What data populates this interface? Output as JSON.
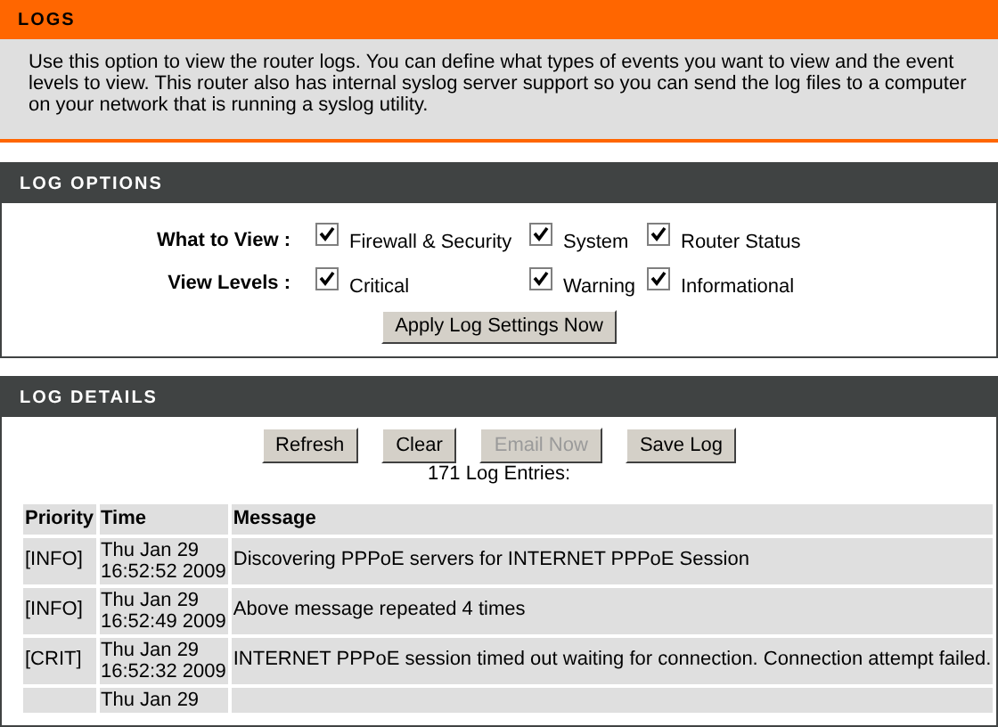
{
  "logs": {
    "title": "LOGS",
    "description": "Use this option to view the router logs. You can define what types of events you want to view and the event levels to view. This router also has internal syslog server support so you can send the log files to a computer on your network that is running a syslog utility."
  },
  "log_options": {
    "title": "LOG OPTIONS",
    "groups": [
      {
        "label": "What to View :",
        "options": [
          {
            "label": "Firewall & Security",
            "checked": true
          },
          {
            "label": "System",
            "checked": true
          },
          {
            "label": "Router Status",
            "checked": true
          }
        ]
      },
      {
        "label": "View Levels :",
        "options": [
          {
            "label": "Critical",
            "checked": true
          },
          {
            "label": "Warning",
            "checked": true
          },
          {
            "label": "Informational",
            "checked": true
          }
        ]
      }
    ],
    "apply_button": "Apply Log Settings Now"
  },
  "log_details": {
    "title": "LOG DETAILS",
    "buttons": [
      {
        "label": "Refresh",
        "disabled": false
      },
      {
        "label": "Clear",
        "disabled": false
      },
      {
        "label": "Email Now",
        "disabled": true
      },
      {
        "label": "Save Log",
        "disabled": false
      }
    ],
    "entries_count": "171 Log Entries:",
    "table": {
      "columns": [
        "Priority",
        "Time",
        "Message"
      ],
      "rows": [
        {
          "priority": "[INFO]",
          "time": [
            "Thu Jan 29",
            "16:52:52 2009"
          ],
          "message": "Discovering PPPoE servers for INTERNET PPPoE Session"
        },
        {
          "priority": "[INFO]",
          "time": [
            "Thu Jan 29",
            "16:52:49 2009"
          ],
          "message": "Above message repeated 4 times"
        },
        {
          "priority": "[CRIT]",
          "time": [
            "Thu Jan 29",
            "16:52:32 2009"
          ],
          "message": "INTERNET PPPoE session timed out waiting for connection. Connection attempt failed."
        },
        {
          "time": [
            "Thu Jan 29"
          ]
        }
      ]
    }
  }
}
